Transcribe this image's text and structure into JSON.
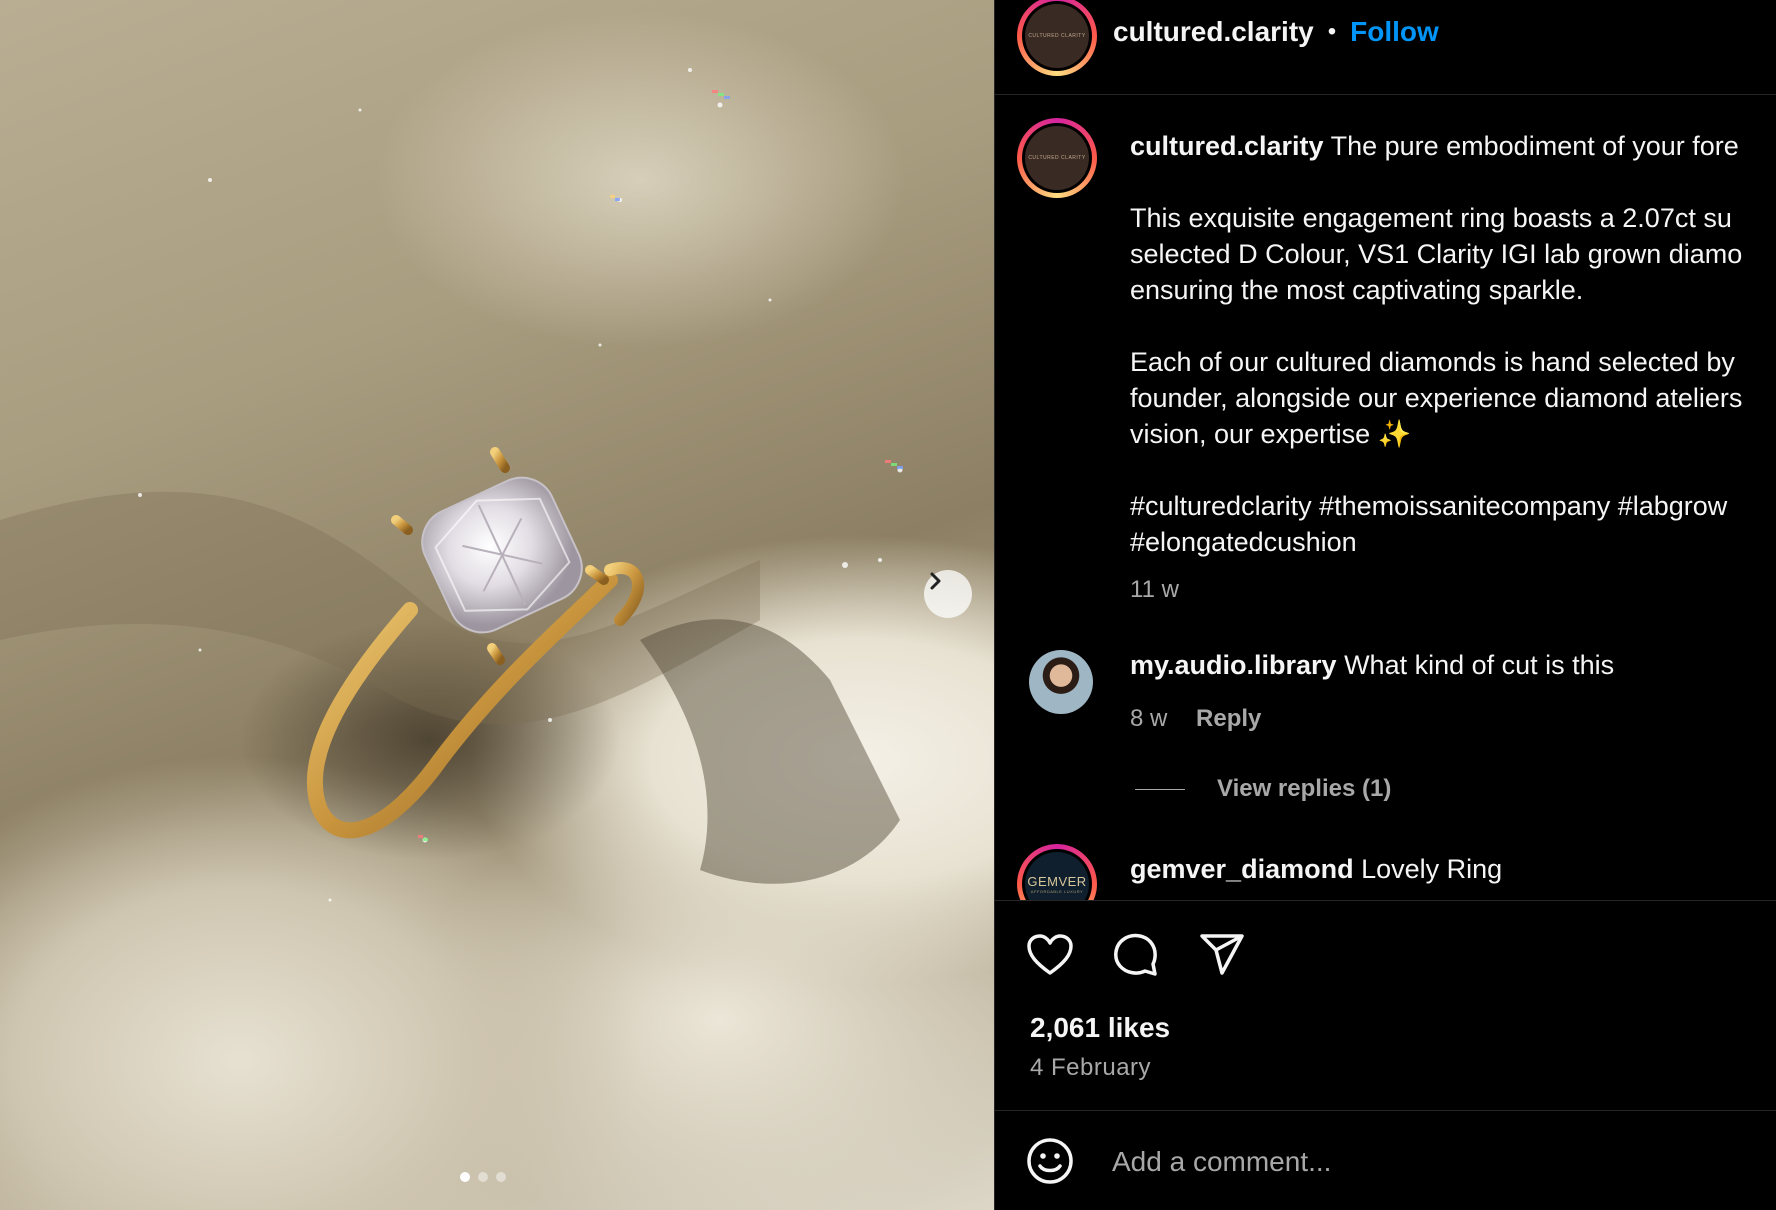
{
  "header": {
    "username": "cultured.clarity",
    "separator": "•",
    "follow_label": "Follow",
    "avatar_text": "CULTURED CLARITY"
  },
  "caption": {
    "username": "cultured.clarity",
    "lines": [
      "The pure embodiment of your fore",
      "This exquisite engagement ring boasts a 2.07ct su",
      "selected D Colour, VS1 Clarity IGI lab grown diamo",
      "ensuring the most captivating sparkle.",
      "Each of our cultured diamonds is hand selected by",
      "founder, alongside our experience diamond ateliers",
      "vision, our expertise ✨",
      "#culturedclarity #themoissanitecompany #labgrow",
      "#elongatedcushion"
    ],
    "time": "11 w"
  },
  "comments": [
    {
      "username": "my.audio.library",
      "text": "What kind of cut is this",
      "time": "8 w",
      "reply_label": "Reply",
      "view_replies": "View replies (1)"
    },
    {
      "username": "gemver_diamond",
      "text": "Lovely Ring",
      "avatar_text": "GEMVER",
      "avatar_sub": "AFFORDABLE LUXURY"
    }
  ],
  "actions": {
    "icons": [
      "heart-icon",
      "comment-icon",
      "share-icon"
    ]
  },
  "likes": "2,061 likes",
  "date": "4 February",
  "add_comment": {
    "placeholder": "Add a comment..."
  },
  "carousel": {
    "dots": 3,
    "active_index": 0
  },
  "colors": {
    "accent": "#0095f6",
    "background": "#000000",
    "muted": "#a8a8a8"
  }
}
